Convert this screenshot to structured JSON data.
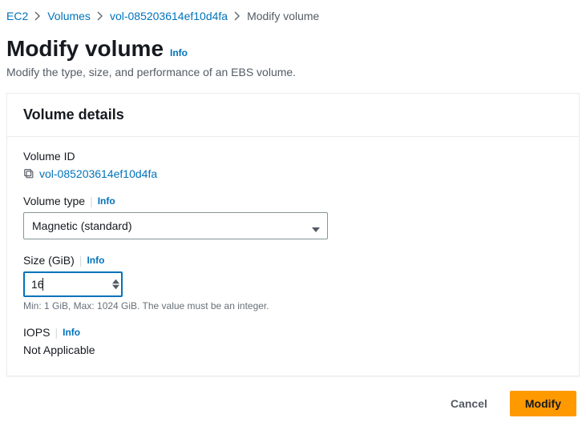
{
  "breadcrumb": {
    "ec2": "EC2",
    "volumes": "Volumes",
    "volume_id": "vol-085203614ef10d4fa",
    "current": "Modify volume"
  },
  "header": {
    "title": "Modify volume",
    "info": "Info",
    "subtitle": "Modify the type, size, and performance of an EBS volume."
  },
  "panel": {
    "title": "Volume details",
    "volume_id": {
      "label": "Volume ID",
      "value": "vol-085203614ef10d4fa"
    },
    "volume_type": {
      "label": "Volume type",
      "info": "Info",
      "selected": "Magnetic (standard)"
    },
    "size": {
      "label": "Size (GiB)",
      "info": "Info",
      "value": "16",
      "hint": "Min: 1 GiB, Max: 1024 GiB. The value must be an integer."
    },
    "iops": {
      "label": "IOPS",
      "info": "Info",
      "value": "Not Applicable"
    }
  },
  "footer": {
    "cancel": "Cancel",
    "modify": "Modify"
  }
}
